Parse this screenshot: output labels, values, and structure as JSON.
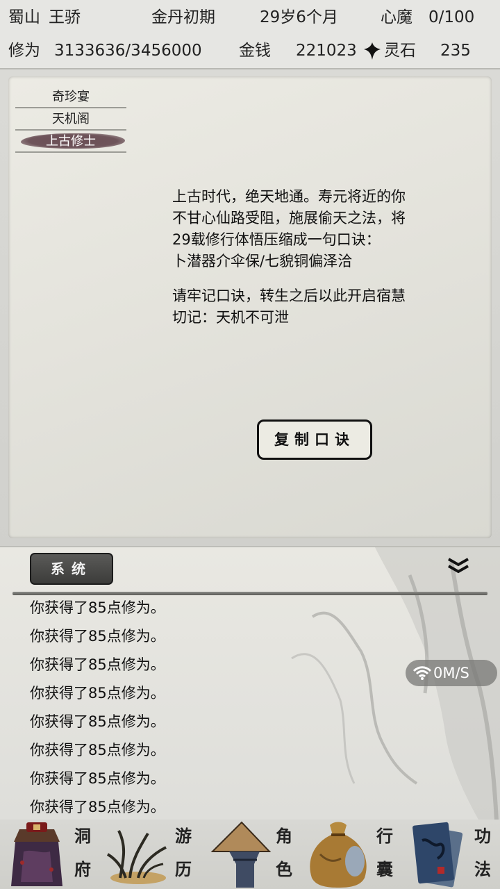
{
  "stats": {
    "sect": "蜀山",
    "name": "王骄",
    "realm": "金丹初期",
    "age": "29岁6个月",
    "demon_label": "心魔",
    "demon_value": "0/100",
    "cultivation_label": "修为",
    "cultivation_value": "3133636/3456000",
    "money_label": "金钱",
    "money_value": "221023",
    "spirit_stone_label": "灵石",
    "spirit_stone_value": "235"
  },
  "tabs": [
    {
      "label": "奇珍宴"
    },
    {
      "label": "天机阁"
    },
    {
      "label": "上古修士"
    }
  ],
  "story": {
    "line1": "上古时代，绝天地通。寿元将近的你",
    "line2": "不甘心仙路受阻，施展偷天之法，将",
    "line3": "29载修行体悟压缩成一句口诀：",
    "line4": "卜潜器介伞保/七貌铜偏泽洽",
    "line5": "请牢记口诀，转生之后以此开启宿慧",
    "line6": "切记：天机不可泄"
  },
  "copy_button": "复制口诀",
  "log": {
    "tab_label": "系统",
    "lines": [
      "你获得了85点修为。",
      "你获得了85点修为。",
      "你获得了85点修为。",
      "你获得了85点修为。",
      "你获得了85点修为。",
      "你获得了85点修为。",
      "你获得了85点修为。",
      "你获得了85点修为。"
    ],
    "collapse_icon": "double-chevron-down-icon"
  },
  "network": {
    "icon": "wifi-icon",
    "rate": "0M/S"
  },
  "nav": [
    {
      "label_top": "洞",
      "label_bottom": "府",
      "icon": "cave-mansion-icon"
    },
    {
      "label_top": "游",
      "label_bottom": "历",
      "icon": "travel-grass-icon"
    },
    {
      "label_top": "角",
      "label_bottom": "色",
      "icon": "character-hat-icon"
    },
    {
      "label_top": "行",
      "label_bottom": "囊",
      "icon": "bag-icon"
    },
    {
      "label_top": "功",
      "label_bottom": "法",
      "icon": "scroll-book-icon"
    }
  ],
  "colors": {
    "active_tab_ink": "#6e545a",
    "paper": "#e8e7e0",
    "dark_button": "#3c3c3a"
  }
}
